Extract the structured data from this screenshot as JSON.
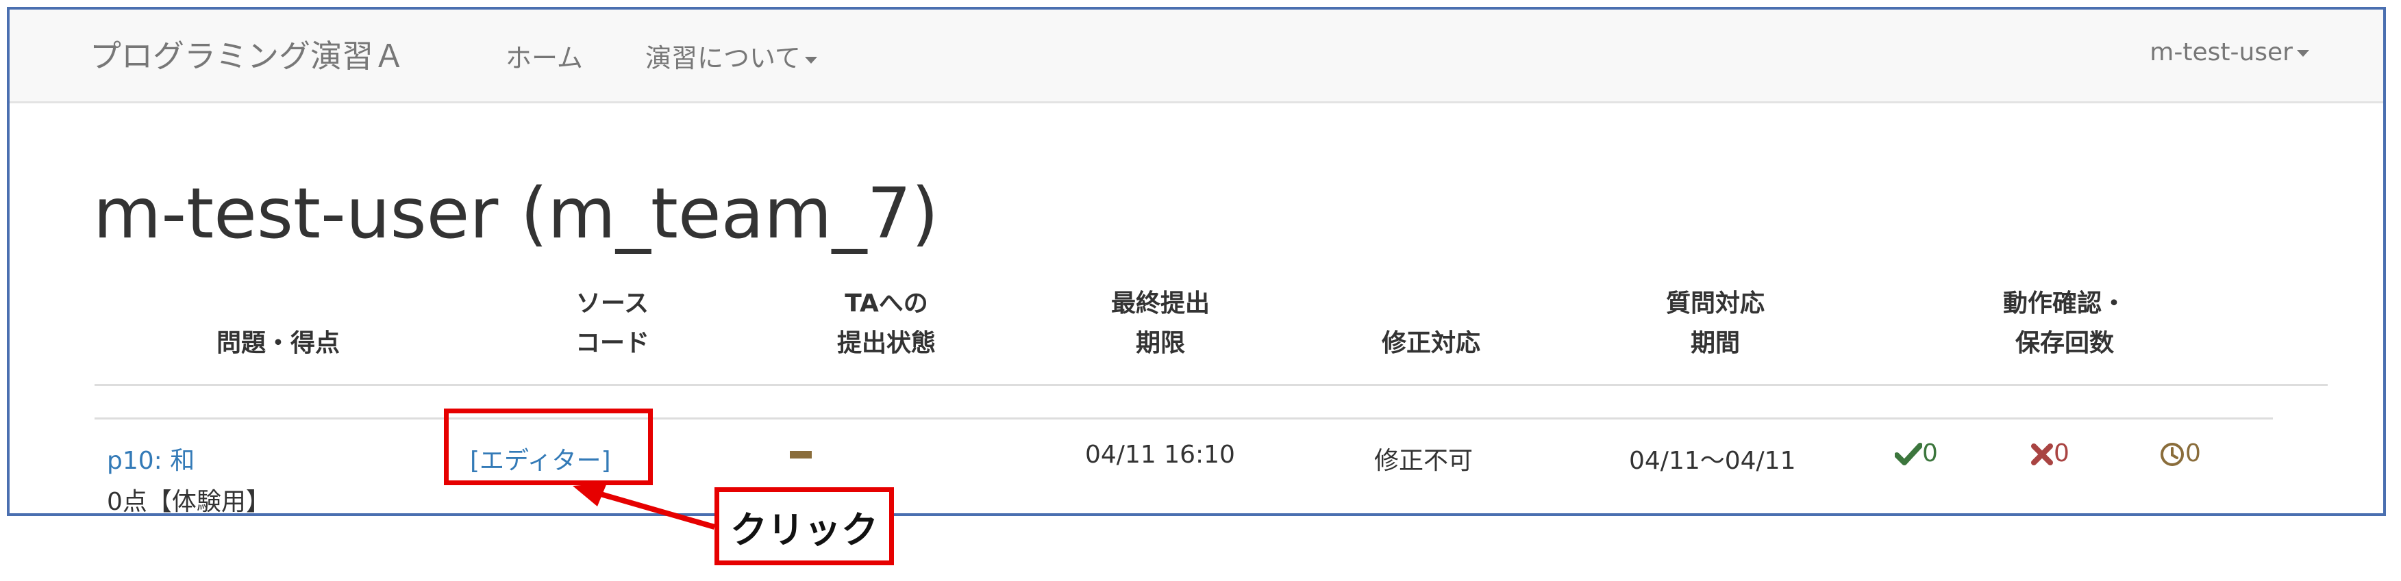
{
  "navbar": {
    "brand": "プログラミング演習Ａ",
    "home": "ホーム",
    "about": "演習について",
    "user": "m-test-user"
  },
  "page": {
    "title": "m-test-user (m_team_7)"
  },
  "table": {
    "headers": [
      [
        "問題・得点"
      ],
      [
        "ソース",
        "コード"
      ],
      [
        "TAへの",
        "提出状態"
      ],
      [
        "最終提出",
        "期限"
      ],
      [
        "修正対応"
      ],
      [
        "質問対応",
        "期間"
      ],
      [
        "動作確認・",
        "保存回数"
      ]
    ],
    "row": {
      "problem_link": "p10: 和",
      "score": "0点【体験用】",
      "editor_link": "[エディター]",
      "deadline": "04/11 16:10",
      "revision": "修正不可",
      "question_period": "04/11～04/11",
      "ok_count": "0",
      "ng_count": "0",
      "saved_count": "0"
    }
  },
  "annotation": {
    "label": "クリック"
  },
  "colors": {
    "accent": "#337ab7",
    "success": "#3c763d",
    "danger": "#a94442",
    "warning": "#8a6d3b",
    "callout": "#e60000"
  }
}
